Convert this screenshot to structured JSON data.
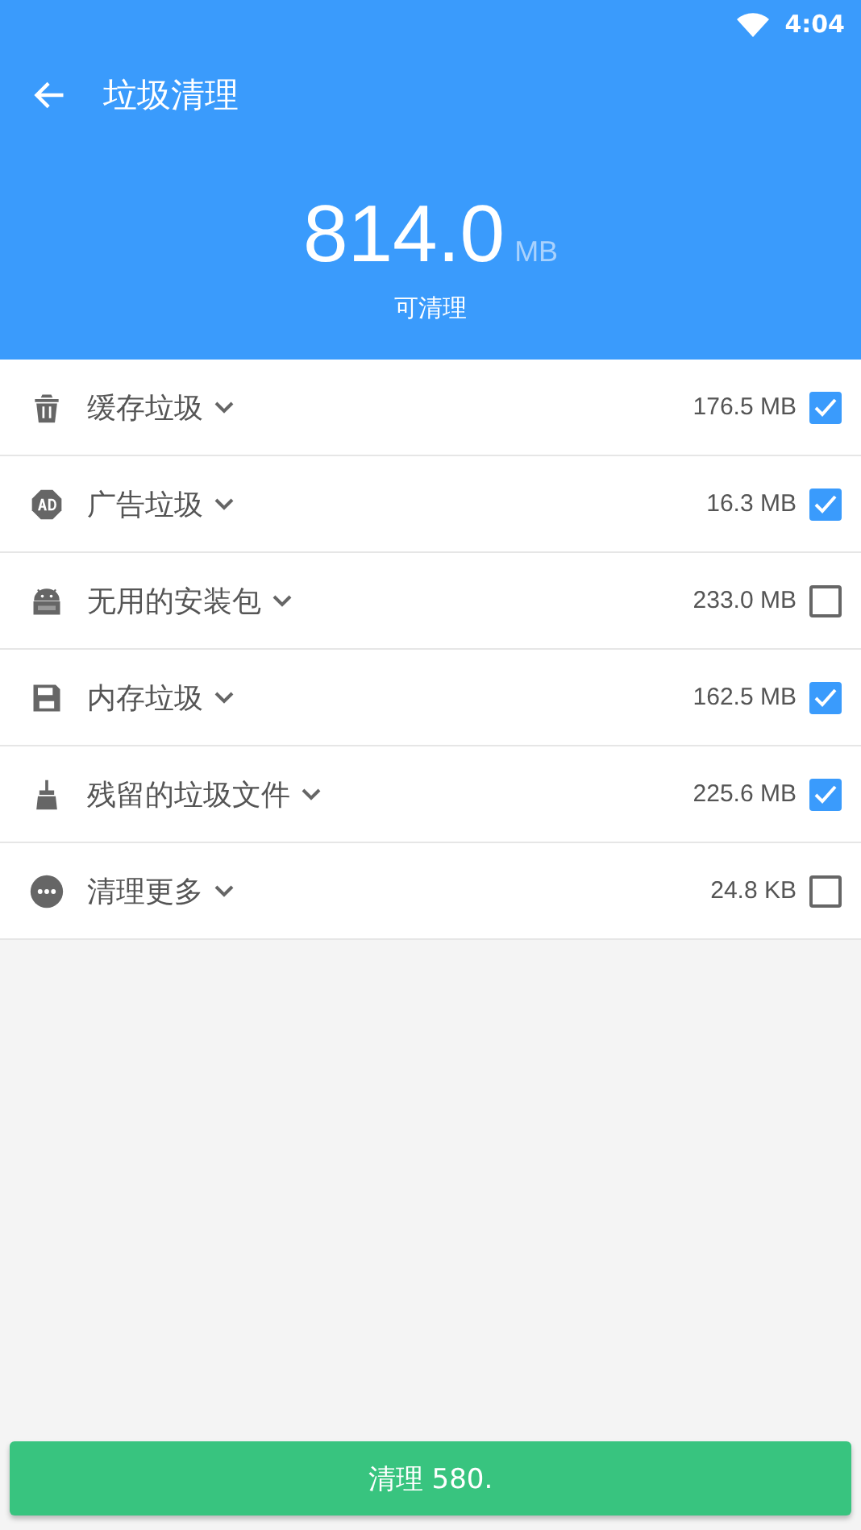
{
  "status_bar": {
    "time": "4:04"
  },
  "toolbar": {
    "title": "垃圾清理"
  },
  "summary": {
    "amount": "814.0",
    "unit": "MB",
    "caption": "可清理"
  },
  "items": [
    {
      "label": "缓存垃圾",
      "size": "176.5 MB",
      "checked": true
    },
    {
      "label": "广告垃圾",
      "size": "16.3 MB",
      "checked": true
    },
    {
      "label": "无用的安装包",
      "size": "233.0 MB",
      "checked": false
    },
    {
      "label": "内存垃圾",
      "size": "162.5 MB",
      "checked": true
    },
    {
      "label": "残留的垃圾文件",
      "size": "225.6 MB",
      "checked": true
    },
    {
      "label": "清理更多",
      "size": "24.8 KB",
      "checked": false
    }
  ],
  "clean_button": {
    "label": "清理 580."
  }
}
